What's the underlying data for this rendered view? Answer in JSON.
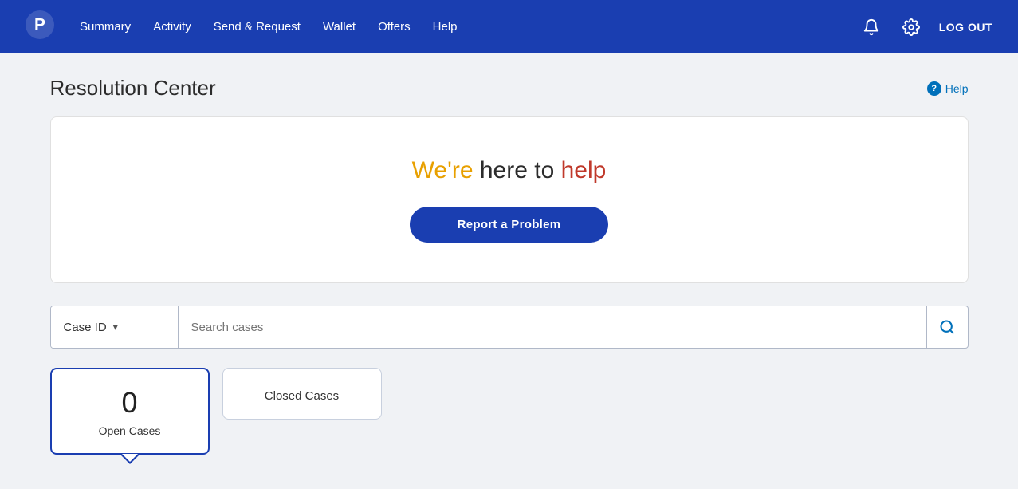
{
  "nav": {
    "logo_label": "PayPal",
    "links": [
      {
        "id": "summary",
        "label": "Summary"
      },
      {
        "id": "activity",
        "label": "Activity"
      },
      {
        "id": "send-request",
        "label": "Send & Request"
      },
      {
        "id": "wallet",
        "label": "Wallet"
      },
      {
        "id": "offers",
        "label": "Offers"
      },
      {
        "id": "help",
        "label": "Help"
      }
    ],
    "logout_label": "LOG OUT",
    "notification_icon": "bell-icon",
    "settings_icon": "gear-icon"
  },
  "page": {
    "title": "Resolution Center",
    "help_label": "Help"
  },
  "hero": {
    "title_we": "We're",
    "title_here": " here to ",
    "title_help": "help",
    "report_button_label": "Report a Problem"
  },
  "search": {
    "dropdown_label": "Case ID",
    "placeholder": "Search cases",
    "search_icon": "search-icon"
  },
  "cases": {
    "open": {
      "count": "0",
      "label": "Open Cases"
    },
    "closed": {
      "label": "Closed Cases"
    }
  }
}
